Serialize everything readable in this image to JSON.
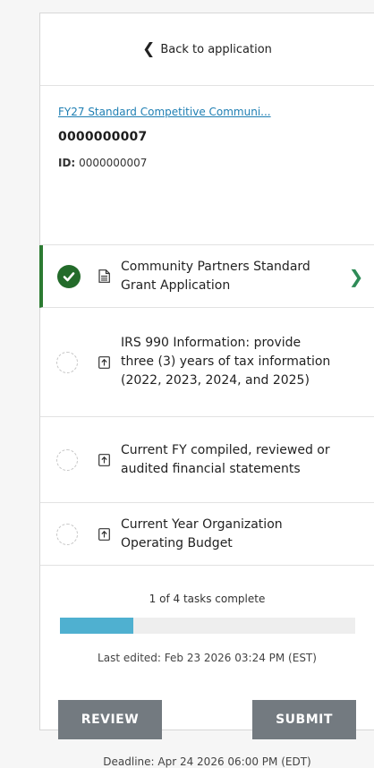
{
  "back": {
    "label": "Back to application"
  },
  "application": {
    "program_link": "FY27 Standard Competitive Communi...",
    "number": "0000000007",
    "id_label": "ID:",
    "id_value": "0000000007"
  },
  "tasks": [
    {
      "title": "Community Partners Standard Grant Application",
      "status": "complete",
      "icon": "document-icon"
    },
    {
      "title": "IRS 990 Information: provide three (3) years of tax information (2022, 2023, 2024, and 2025)",
      "status": "incomplete",
      "icon": "upload-icon"
    },
    {
      "title": "Current FY compiled, reviewed or audited financial statements",
      "status": "incomplete",
      "icon": "upload-icon"
    },
    {
      "title": "Current Year Organization Operating Budget",
      "status": "incomplete",
      "icon": "upload-icon"
    }
  ],
  "progress": {
    "text": "1 of 4 tasks complete",
    "completed": 1,
    "total": 4,
    "fill_color": "#4fb0d0"
  },
  "last_edited": "Last edited: Feb 23 2026 03:24 PM (EST)",
  "actions": {
    "review": "REVIEW",
    "submit": "SUBMIT"
  },
  "deadline": "Deadline: Apr 24 2026 06:00 PM (EDT)",
  "colors": {
    "complete": "#236b2a",
    "active_border": "#2c7b32",
    "link": "#1f7fb3",
    "button": "#737a80"
  }
}
